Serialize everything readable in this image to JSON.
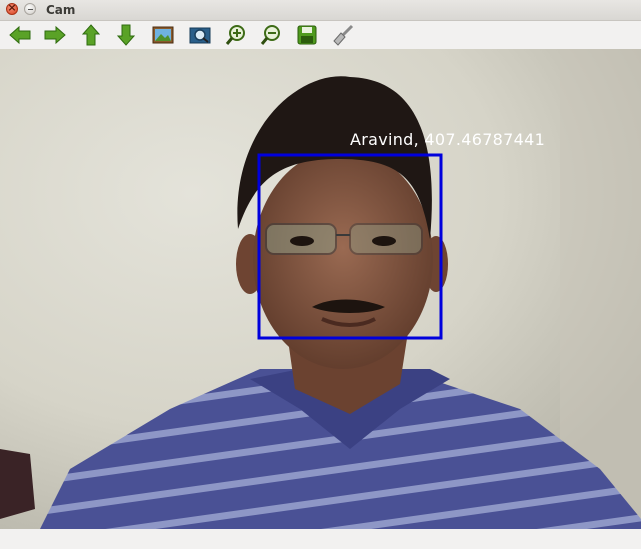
{
  "window": {
    "title": "Cam"
  },
  "toolbar": {
    "buttons": [
      {
        "name": "pan-left",
        "icon": "arrow-left-icon"
      },
      {
        "name": "pan-right",
        "icon": "arrow-right-icon"
      },
      {
        "name": "pan-up",
        "icon": "arrow-up-icon"
      },
      {
        "name": "pan-down",
        "icon": "arrow-down-icon"
      },
      {
        "name": "image",
        "icon": "image-icon"
      },
      {
        "name": "zoom-fit",
        "icon": "zoom-fit-icon"
      },
      {
        "name": "zoom-in",
        "icon": "zoom-in-icon"
      },
      {
        "name": "zoom-out",
        "icon": "zoom-out-icon"
      },
      {
        "name": "save",
        "icon": "save-icon"
      },
      {
        "name": "clear",
        "icon": "brush-icon"
      }
    ]
  },
  "camera": {
    "detection_label": "Aravind, 407.46787441",
    "box_color": "#0000dd",
    "label_color": "#ffffff"
  }
}
